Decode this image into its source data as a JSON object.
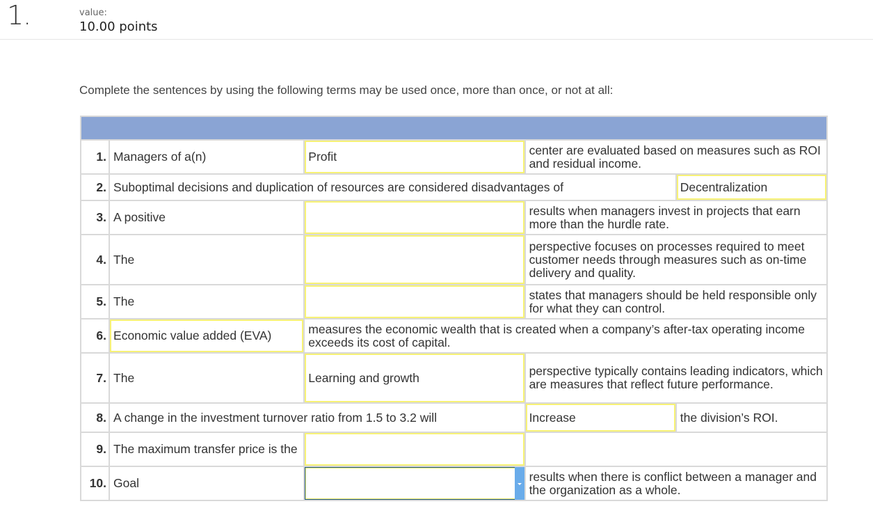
{
  "question": {
    "number": "1.",
    "value_label": "value:",
    "points": "10.00 points"
  },
  "instructions": "Complete the sentences by using the following terms may be used once, more than once, or not at all:",
  "colors": {
    "header_band": "#8aa4d4",
    "answer_highlight": "#f7f275",
    "dropdown_arrow": "#6aacea",
    "dropdown_focus_border": "#1d5680"
  },
  "rows": [
    {
      "num": "1.",
      "prefix": "Managers of a(n)",
      "answer": "Profit",
      "suffix": "center are evaluated based on measures such as ROI and residual income."
    },
    {
      "num": "2.",
      "prefix": "Suboptimal decisions and duplication of resources are considered disadvantages of",
      "answer": "Decentralization"
    },
    {
      "num": "3.",
      "prefix": "A positive",
      "answer": "",
      "suffix": "results when managers invest in projects that earn more than the hurdle rate."
    },
    {
      "num": "4.",
      "prefix": "The",
      "answer": "",
      "suffix": "perspective focuses on processes required to meet customer needs through measures such as on-time delivery and quality."
    },
    {
      "num": "5.",
      "prefix": "The",
      "answer": "",
      "suffix": "states that managers should be held responsible only for what they can control."
    },
    {
      "num": "6.",
      "answer": "Economic value added (EVA)",
      "suffix": "measures the economic wealth that is created when a company’s after-tax operating income exceeds its cost of capital."
    },
    {
      "num": "7.",
      "prefix": "The",
      "answer": "Learning and growth",
      "suffix": "perspective typically contains leading indicators, which are measures that reflect future performance."
    },
    {
      "num": "8.",
      "prefix": "A change in the investment turnover ratio from 1.5 to 3.2 will",
      "answer": "Increase",
      "suffix": "the division’s ROI."
    },
    {
      "num": "9.",
      "prefix": "The maximum transfer price is the",
      "answer": ""
    },
    {
      "num": "10.",
      "prefix": "Goal",
      "answer": "",
      "suffix": "results when there is conflict between a manager and the organization as a whole.",
      "dropdown_icon": "chevron-down-icon"
    }
  ]
}
